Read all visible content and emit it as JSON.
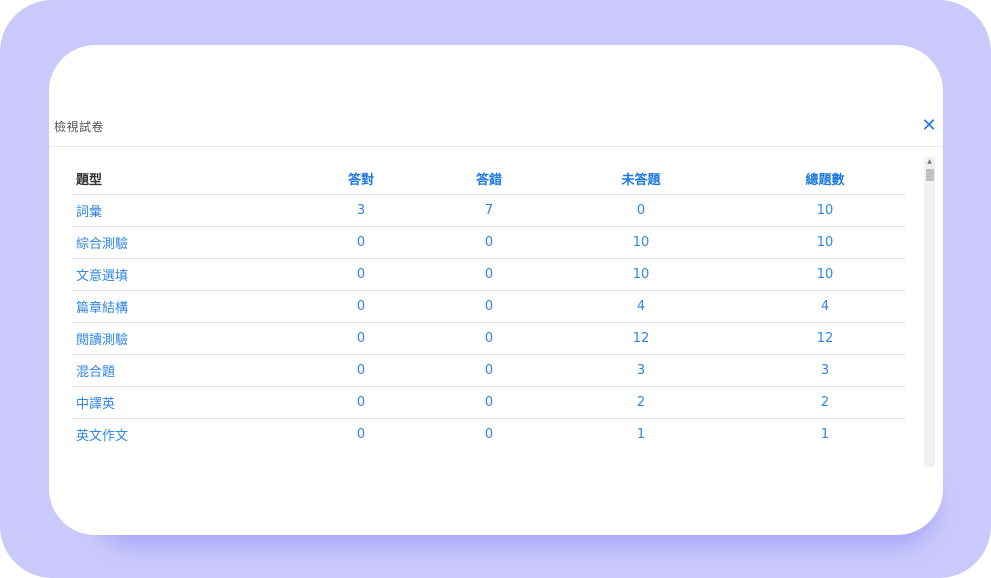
{
  "dialog": {
    "title": "檢視試卷",
    "close_icon": "close-icon"
  },
  "table": {
    "headers": [
      "題型",
      "答對",
      "答錯",
      "未答題",
      "總題數"
    ],
    "rows": [
      [
        "詞彙",
        "3",
        "7",
        "0",
        "10"
      ],
      [
        "綜合測驗",
        "0",
        "0",
        "10",
        "10"
      ],
      [
        "文意選填",
        "0",
        "0",
        "10",
        "10"
      ],
      [
        "篇章結構",
        "0",
        "0",
        "4",
        "4"
      ],
      [
        "閱讀測驗",
        "0",
        "0",
        "12",
        "12"
      ],
      [
        "混合題",
        "0",
        "0",
        "3",
        "3"
      ],
      [
        "中譯英",
        "0",
        "0",
        "2",
        "2"
      ],
      [
        "英文作文",
        "0",
        "0",
        "1",
        "1"
      ]
    ]
  },
  "colors": {
    "accent": "#1f7ae0",
    "background": "#cbc9fb"
  }
}
